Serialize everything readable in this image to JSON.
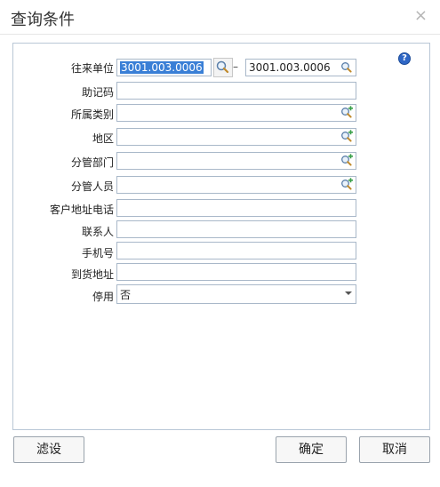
{
  "window": {
    "title": "查询条件",
    "close_glyph": "×"
  },
  "form": {
    "help_glyph": "?",
    "fields": {
      "counterparty": {
        "label": "往来单位",
        "from_value": "3001.003.0006",
        "dash": "–",
        "to_value": "3001.003.0006"
      },
      "mnemonic": {
        "label": "助记码",
        "value": ""
      },
      "category": {
        "label": "所属类别",
        "value": ""
      },
      "region": {
        "label": "地区",
        "value": ""
      },
      "department": {
        "label": "分管部门",
        "value": ""
      },
      "staff": {
        "label": "分管人员",
        "value": ""
      },
      "contact_phone": {
        "label": "客户地址电话",
        "value": ""
      },
      "contact": {
        "label": "联系人",
        "value": ""
      },
      "mobile": {
        "label": "手机号",
        "value": ""
      },
      "delivery_address": {
        "label": "到货地址",
        "value": ""
      },
      "disabled": {
        "label": "停用",
        "value": "否"
      }
    }
  },
  "buttons": {
    "filter": "滤设",
    "ok": "确定",
    "cancel": "取消"
  },
  "icons": {
    "search": "search-icon",
    "lookup": "lookup-icon",
    "help": "help-icon"
  }
}
